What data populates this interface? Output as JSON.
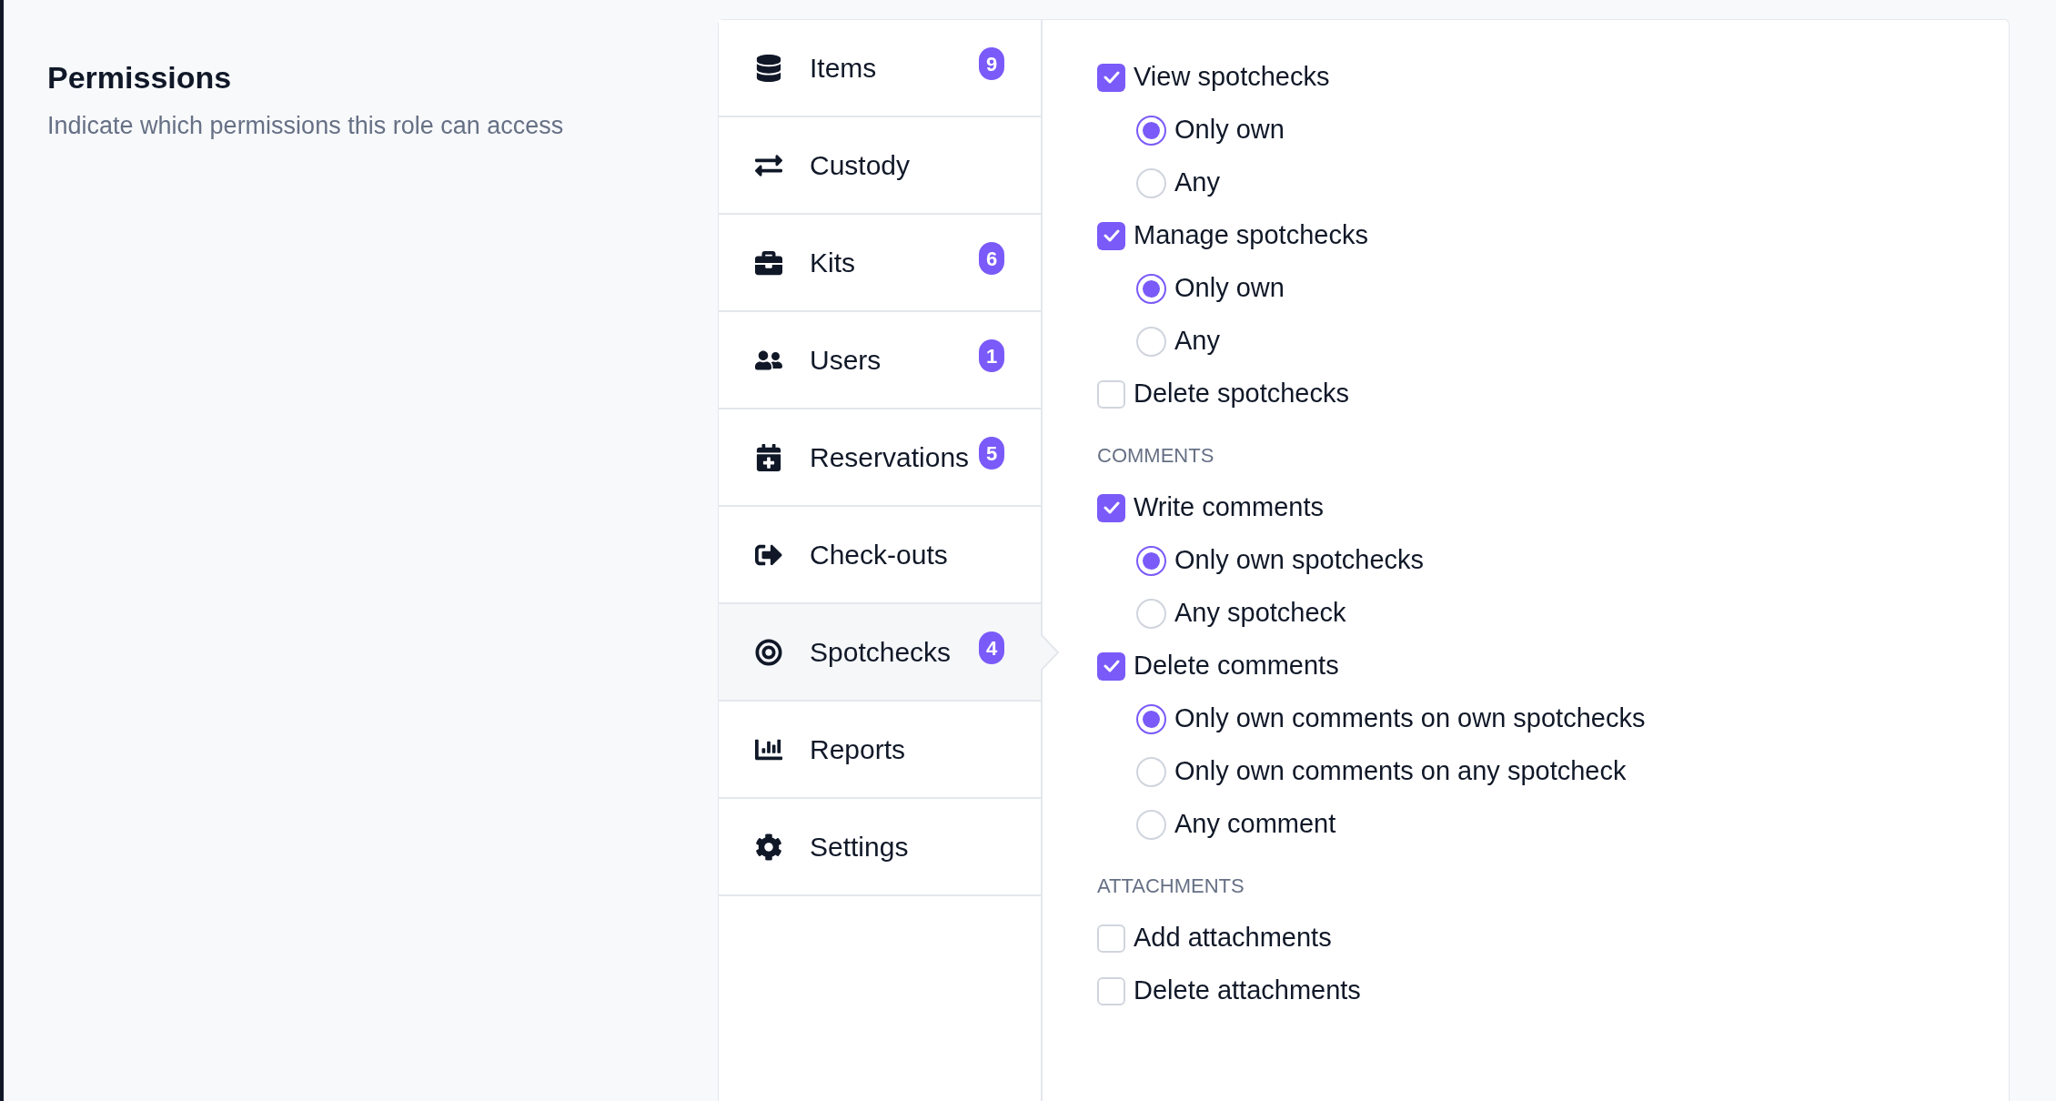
{
  "header": {
    "title": "Permissions",
    "description": "Indicate which permissions this role can access"
  },
  "nav": [
    {
      "label": "Items",
      "badge": "9",
      "selected": false
    },
    {
      "label": "Custody",
      "selected": false
    },
    {
      "label": "Kits",
      "badge": "6",
      "selected": false
    },
    {
      "label": "Users",
      "badge": "1",
      "selected": false
    },
    {
      "label": "Reservations",
      "badge": "5",
      "selected": false
    },
    {
      "label": "Check-outs",
      "selected": false
    },
    {
      "label": "Spotchecks",
      "badge": "4",
      "selected": true
    },
    {
      "label": "Reports",
      "selected": false
    },
    {
      "label": "Settings",
      "selected": false
    }
  ],
  "sections": [
    {
      "permissions": [
        {
          "label": "View spotchecks",
          "checked": true,
          "options": [
            {
              "label": "Only own",
              "selected": true
            },
            {
              "label": "Any",
              "selected": false
            }
          ]
        },
        {
          "label": "Manage spotchecks",
          "checked": true,
          "options": [
            {
              "label": "Only own",
              "selected": true
            },
            {
              "label": "Any",
              "selected": false
            }
          ]
        },
        {
          "label": "Delete spotchecks",
          "checked": false
        }
      ]
    },
    {
      "heading": "COMMENTS",
      "permissions": [
        {
          "label": "Write comments",
          "checked": true,
          "options": [
            {
              "label": "Only own spotchecks",
              "selected": true
            },
            {
              "label": "Any spotcheck",
              "selected": false
            }
          ]
        },
        {
          "label": "Delete comments",
          "checked": true,
          "options": [
            {
              "label": "Only own comments on own spotchecks",
              "selected": true
            },
            {
              "label": "Only own comments on any spotcheck",
              "selected": false
            },
            {
              "label": "Any comment",
              "selected": false
            }
          ]
        }
      ]
    },
    {
      "heading": "ATTACHMENTS",
      "permissions": [
        {
          "label": "Add attachments",
          "checked": false
        },
        {
          "label": "Delete attachments",
          "checked": false
        }
      ]
    }
  ]
}
